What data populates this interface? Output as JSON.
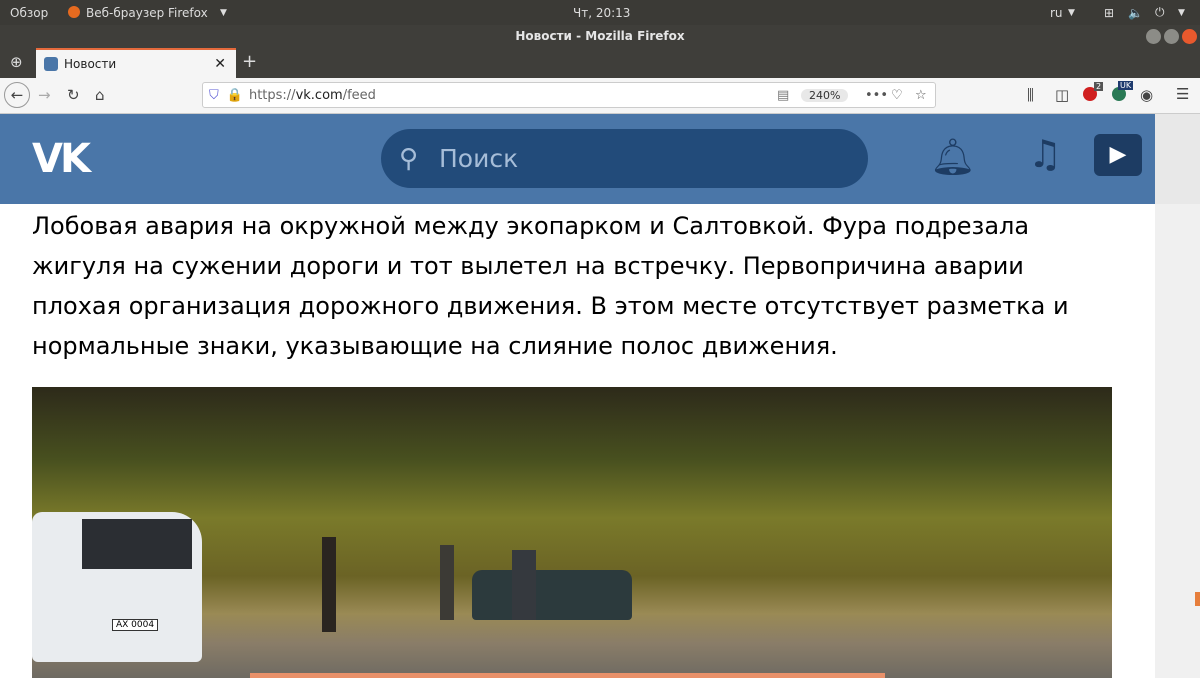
{
  "system": {
    "overview": "Обзор",
    "app": "Веб-браузер Firefox",
    "clock": "Чт, 20:13",
    "lang": "ru"
  },
  "window": {
    "title": "Новости - Mozilla Firefox"
  },
  "tab": {
    "label": "Новости"
  },
  "navbar": {
    "url_scheme": "https://",
    "url_host": "vk.com",
    "url_path": "/feed",
    "zoom": "240%",
    "abp_badge": "2",
    "translate_badge": "UK"
  },
  "vk": {
    "search_placeholder": "Поиск"
  },
  "post": {
    "text": "Лобовая авария на окружной между экопарком и Салтовкой. Фура подрезала жигуля на сужении дороги и тот вылетел на встречку. Первопричина аварии плохая организация дорожного движения. В этом месте отсутствует разметка и нормальные знаки, указывающие на слияние полос движения.",
    "plate": "АХ 0004"
  }
}
